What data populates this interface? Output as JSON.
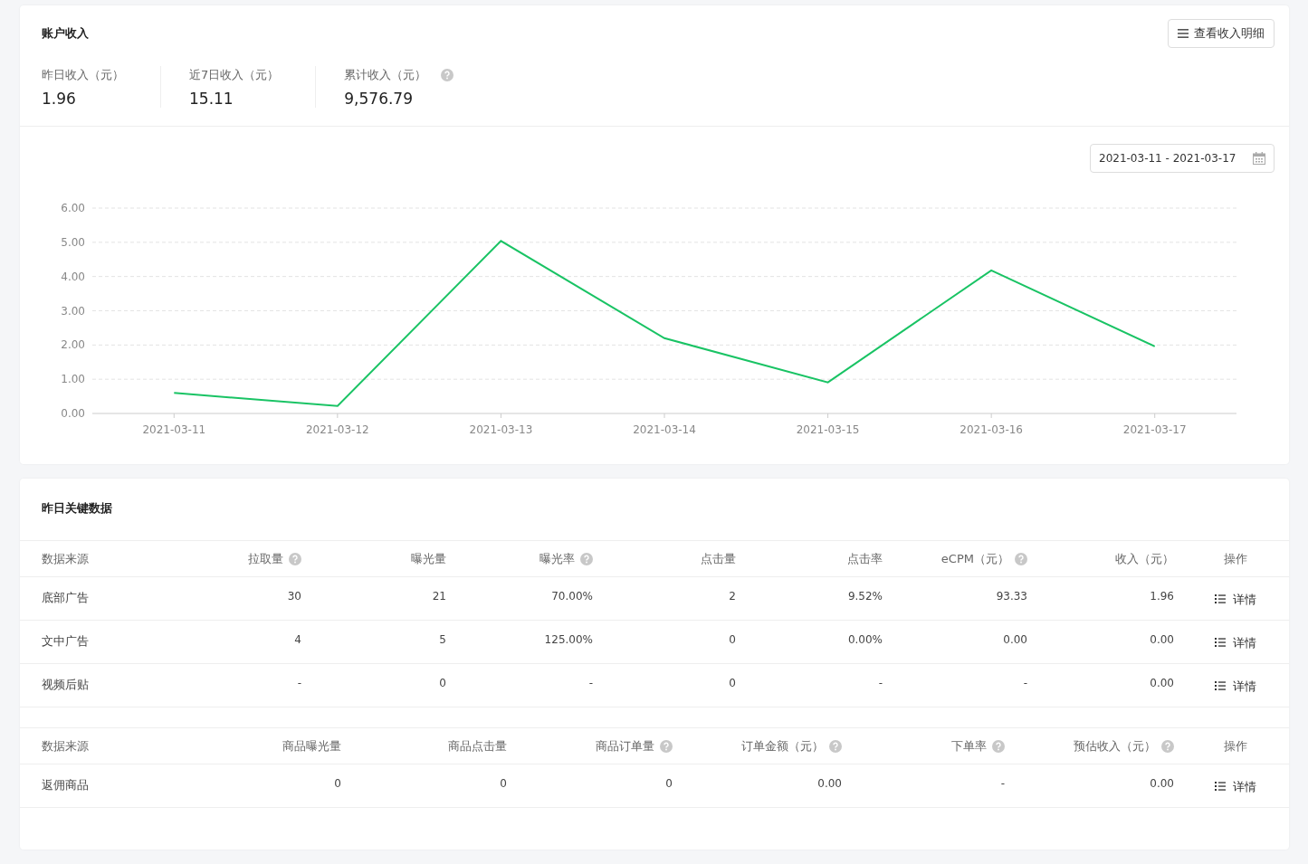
{
  "account_income": {
    "title": "账户收入",
    "detail_button": "查看收入明细",
    "stats": [
      {
        "label": "昨日收入（元）",
        "value": "1.96",
        "help": false
      },
      {
        "label": "近7日收入（元）",
        "value": "15.11",
        "help": false
      },
      {
        "label": "累计收入（元）",
        "value": "9,576.79",
        "help": true
      }
    ],
    "date_range": "2021-03-11 - 2021-03-17",
    "chart_data": {
      "type": "line",
      "categories": [
        "2021-03-11",
        "2021-03-12",
        "2021-03-13",
        "2021-03-14",
        "2021-03-15",
        "2021-03-16",
        "2021-03-17"
      ],
      "grid": true,
      "series": [
        {
          "color": "#19c364",
          "values": [
            0.6,
            0.22,
            5.04,
            2.2,
            0.91,
            4.18,
            1.96
          ]
        }
      ],
      "ylim": [
        0,
        6
      ],
      "yticks": [
        {
          "value": 0,
          "label": "0.00"
        },
        {
          "value": 1,
          "label": "1.00"
        },
        {
          "value": 2,
          "label": "2.00"
        },
        {
          "value": 3,
          "label": "3.00"
        },
        {
          "value": 4,
          "label": "4.00"
        },
        {
          "value": 5,
          "label": "5.00"
        },
        {
          "value": 6,
          "label": "6.00"
        }
      ]
    }
  },
  "key_data": {
    "title": "昨日关键数据",
    "tables": [
      {
        "columns": [
          {
            "label": "数据来源",
            "help": false
          },
          {
            "label": "拉取量",
            "help": true
          },
          {
            "label": "曝光量",
            "help": false
          },
          {
            "label": "曝光率",
            "help": true
          },
          {
            "label": "点击量",
            "help": false
          },
          {
            "label": "点击率",
            "help": false
          },
          {
            "label": "eCPM（元）",
            "help": true
          },
          {
            "label": "收入（元）",
            "help": false
          },
          {
            "label": "操作",
            "help": false
          }
        ],
        "rows": [
          {
            "cells": [
              "底部广告",
              "30",
              "21",
              "70.00%",
              "2",
              "9.52%",
              "93.33",
              "1.96"
            ],
            "action": "详情"
          },
          {
            "cells": [
              "文中广告",
              "4",
              "5",
              "125.00%",
              "0",
              "0.00%",
              "0.00",
              "0.00"
            ],
            "action": "详情"
          },
          {
            "cells": [
              "视频后贴",
              "-",
              "0",
              "-",
              "0",
              "-",
              "-",
              "0.00"
            ],
            "action": "详情"
          }
        ]
      },
      {
        "columns": [
          {
            "label": "数据来源",
            "help": false
          },
          {
            "label": "商品曝光量",
            "help": false
          },
          {
            "label": "商品点击量",
            "help": false
          },
          {
            "label": "商品订单量",
            "help": true
          },
          {
            "label": "订单金额（元）",
            "help": true
          },
          {
            "label": "下单率",
            "help": true
          },
          {
            "label": "预估收入（元）",
            "help": true
          },
          {
            "label": "操作",
            "help": false
          }
        ],
        "rows": [
          {
            "cells": [
              "返佣商品",
              "0",
              "0",
              "0",
              "0.00",
              "-",
              "0.00"
            ],
            "action": "详情"
          }
        ]
      }
    ]
  }
}
